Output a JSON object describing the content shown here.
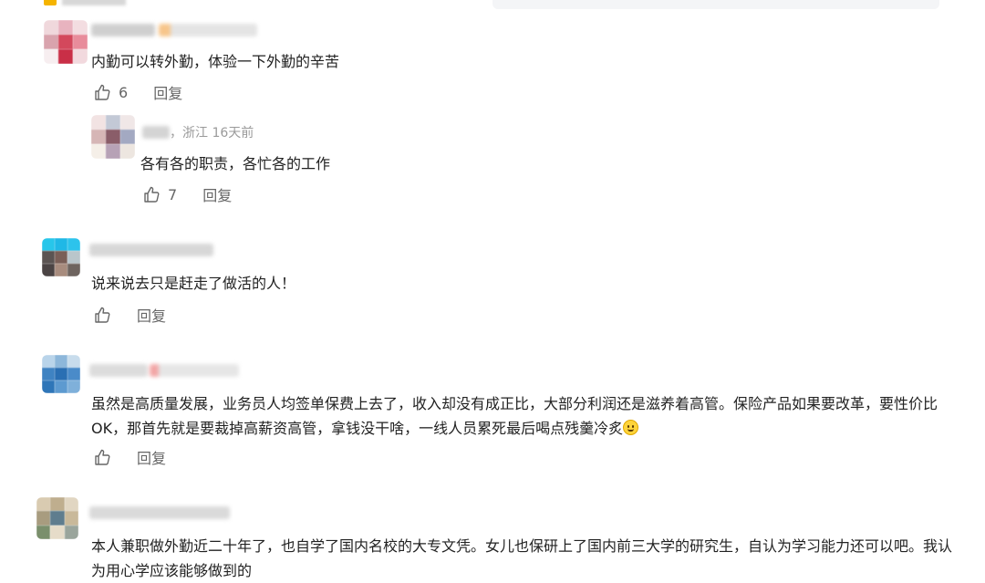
{
  "comments": [
    {
      "text": "内勤可以转外勤，体验一下外勤的辛苦",
      "likes": "6",
      "reply_label": "回复",
      "replies": [
        {
          "location": "，浙江",
          "time": "16天前",
          "text": "各有各的职责，各忙各的工作",
          "likes": "7",
          "reply_label": "回复"
        }
      ]
    },
    {
      "text": "说来说去只是赶走了做活的人！",
      "likes": "",
      "reply_label": "回复"
    },
    {
      "text": "虽然是高质量发展，业务员人均签单保费上去了，收入却没有成正比，大部分利润还是滋养着高管。保险产品如果要改革，要性价比OK，那首先就是要裁掉高薪资高管，拿钱没干啥，一线人员累死最后喝点残羹冷炙",
      "emoji": "grinning-emoji",
      "likes": "",
      "reply_label": "回复"
    },
    {
      "text": "本人兼职做外勤近二十年了，也自学了国内名校的大专文凭。女儿也保研上了国内前三大学的研究生，自认为学习能力还可以吧。我认为用心学应该能够做到的",
      "likes": "",
      "reply_label": "回复"
    }
  ],
  "icons": {
    "like": "thumbs-up-icon"
  },
  "colors": {
    "text": "#222222",
    "secondary": "#666666",
    "meta": "#9a9a9a",
    "accent": "#f5b400"
  }
}
